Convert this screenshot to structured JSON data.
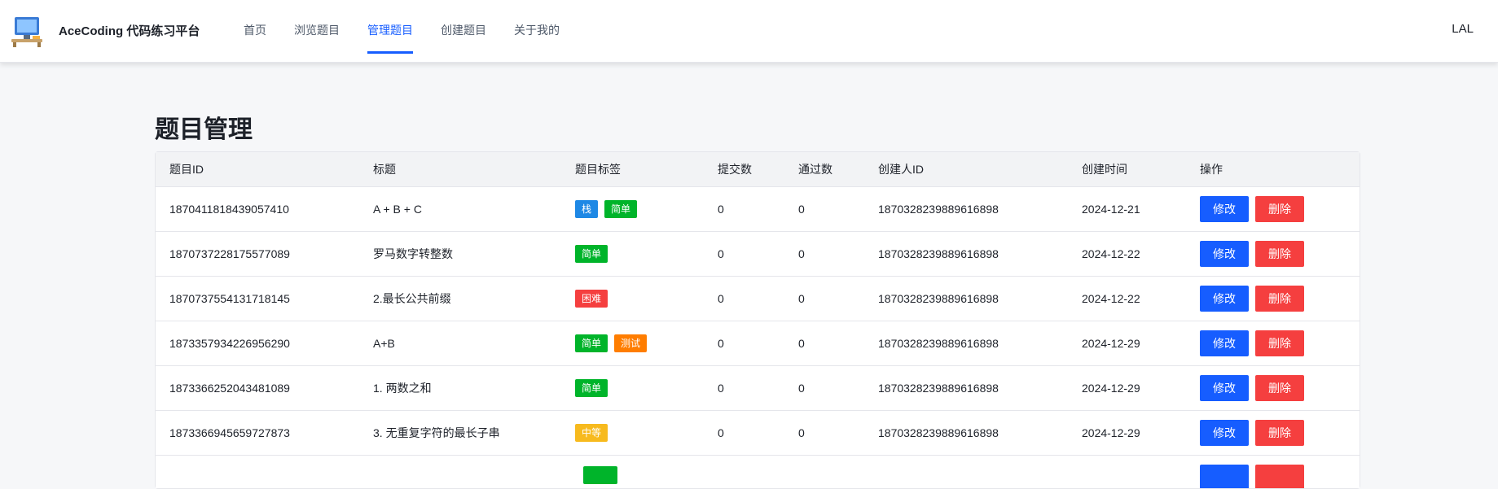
{
  "app": {
    "name": "AceCoding 代码练习平台",
    "logo_icon": "computer-desk-icon"
  },
  "nav": [
    {
      "label": "首页",
      "active": false
    },
    {
      "label": "浏览题目",
      "active": false
    },
    {
      "label": "管理题目",
      "active": true
    },
    {
      "label": "创建题目",
      "active": false
    },
    {
      "label": "关于我的",
      "active": false
    }
  ],
  "user": {
    "name": "LAL"
  },
  "page": {
    "title": "题目管理"
  },
  "table": {
    "columns": [
      "题目ID",
      "标题",
      "题目标签",
      "提交数",
      "通过数",
      "创建人ID",
      "创建时间",
      "操作"
    ],
    "edit_label": "修改",
    "delete_label": "删除",
    "rows": [
      {
        "id": "1870411818439057410",
        "title": "A + B + C",
        "tags": [
          {
            "label": "栈",
            "color": "#1e88e5"
          },
          {
            "label": "简单",
            "color": "#00b42a"
          }
        ],
        "submit": "0",
        "accepted": "0",
        "creator": "1870328239889616898",
        "created": "2024-12-21"
      },
      {
        "id": "1870737228175577089",
        "title": "罗马数字转整数",
        "tags": [
          {
            "label": "简单",
            "color": "#00b42a"
          }
        ],
        "submit": "0",
        "accepted": "0",
        "creator": "1870328239889616898",
        "created": "2024-12-22"
      },
      {
        "id": "1870737554131718145",
        "title": "2.最长公共前缀",
        "tags": [
          {
            "label": "困难",
            "color": "#f53f3f"
          }
        ],
        "submit": "0",
        "accepted": "0",
        "creator": "1870328239889616898",
        "created": "2024-12-22"
      },
      {
        "id": "1873357934226956290",
        "title": "A+B",
        "tags": [
          {
            "label": "简单",
            "color": "#00b42a"
          },
          {
            "label": "测试",
            "color": "#ff7d00"
          }
        ],
        "submit": "0",
        "accepted": "0",
        "creator": "1870328239889616898",
        "created": "2024-12-29"
      },
      {
        "id": "1873366252043481089",
        "title": "1. 两数之和",
        "tags": [
          {
            "label": "简单",
            "color": "#00b42a"
          }
        ],
        "submit": "0",
        "accepted": "0",
        "creator": "1870328239889616898",
        "created": "2024-12-29"
      },
      {
        "id": "1873366945659727873",
        "title": "3. 无重复字符的最长子串",
        "tags": [
          {
            "label": "中等",
            "color": "#f7ba1e"
          }
        ],
        "submit": "0",
        "accepted": "0",
        "creator": "1870328239889616898",
        "created": "2024-12-29"
      }
    ],
    "partial_row_tag_color": "#00b42a"
  }
}
